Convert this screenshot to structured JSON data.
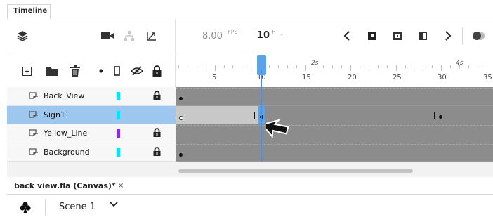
{
  "panel": {
    "tab_label": "Timeline"
  },
  "toolbar": {
    "fps_value": "8.00",
    "fps_unit": "FPS",
    "frame_value": "10",
    "frame_unit": "F",
    "frame_suffix": "-"
  },
  "ruler": {
    "frame_numbers": [
      "5",
      "10",
      "15",
      "20",
      "25",
      "30",
      "35"
    ],
    "seconds": [
      "2s",
      "4s"
    ]
  },
  "layers": [
    {
      "name": "Back_View",
      "color": "#00e5ff",
      "locked": true,
      "selected": false
    },
    {
      "name": "Sign1",
      "color": "#00e5ff",
      "locked": false,
      "selected": true
    },
    {
      "name": "Yellow_Line",
      "color": "#8a2be2",
      "locked": true,
      "selected": false
    },
    {
      "name": "Background",
      "color": "#00e5ff",
      "locked": true,
      "selected": false
    }
  ],
  "document": {
    "tab_label": "back view.fla (Canvas)*",
    "close_glyph": "×"
  },
  "scene": {
    "label": "Scene 1"
  },
  "colors": {
    "selection": "#9ec7f0",
    "playhead": "#5ba2e6"
  }
}
